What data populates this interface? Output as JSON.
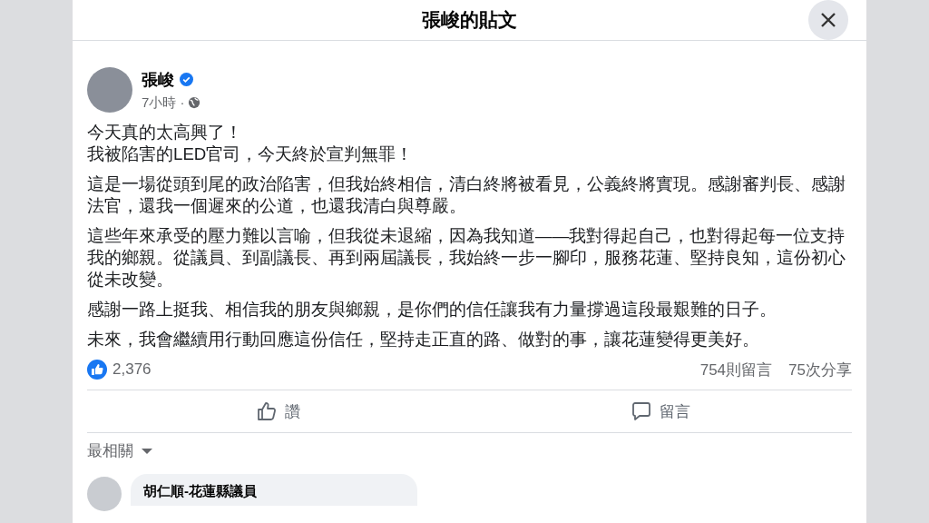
{
  "dialog": {
    "title": "張峻的貼文"
  },
  "post": {
    "author": "張峻",
    "verified": true,
    "time": "7小時 ·",
    "paragraphs": [
      [
        "今天真的太高興了！",
        "我被陷害的LED官司，今天終於宣判無罪！"
      ],
      [
        "這是一場從頭到尾的政治陷害，但我始終相信，清白終將被看見，公義終將實現。感謝審判長、感謝法官，還我一個遲來的公道，也還我清白與尊嚴。"
      ],
      [
        "這些年來承受的壓力難以言喻，但我從未退縮，因為我知道——我對得起自己，也對得起每一位支持我的鄉親。從議員、到副議長、再到兩屆議長，我始終一步一腳印，服務花蓮、堅持良知，這份初心從未改變。"
      ],
      [
        "感謝一路上挺我、相信我的朋友與鄉親，是你們的信任讓我有力量撐過這段最艱難的日子。"
      ],
      [
        "未來，我會繼續用行動回應這份信任，堅持走正直的路、做對的事，讓花蓮變得更美好。"
      ]
    ],
    "reactions": "2,376",
    "comment_count": "754則留言",
    "share_count": "75次分享",
    "actions": [
      {
        "kind": "like",
        "label": "讚"
      },
      {
        "kind": "comment",
        "label": "留言"
      }
    ]
  },
  "comment_sort": "最相關",
  "comments": [
    {
      "author": "胡仁順-花蓮縣議員"
    }
  ]
}
